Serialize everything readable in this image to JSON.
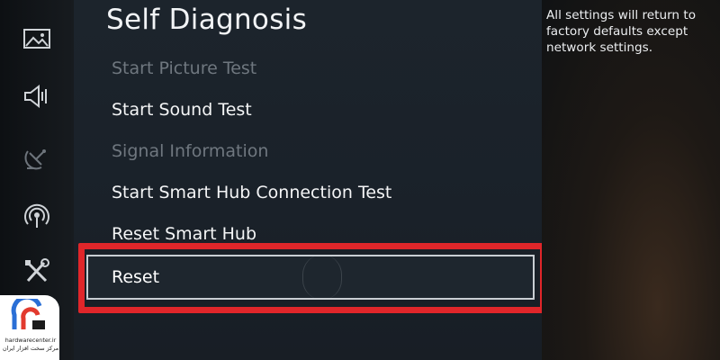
{
  "title": "Self Diagnosis",
  "menu": {
    "items": [
      {
        "label": "Start Picture Test",
        "state": "disabled"
      },
      {
        "label": "Start Sound Test",
        "state": "enabled"
      },
      {
        "label": "Signal Information",
        "state": "disabled"
      },
      {
        "label": "Start Smart Hub Connection Test",
        "state": "enabled"
      },
      {
        "label": "Reset Smart Hub",
        "state": "enabled"
      },
      {
        "label": "Reset",
        "state": "focused"
      }
    ]
  },
  "info": {
    "text": "All settings will return to factory defaults except network settings."
  },
  "sidebar": {
    "icons": [
      "picture-icon",
      "sound-icon",
      "broadcast-icon",
      "network-icon",
      "support-icon"
    ]
  },
  "highlight_color": "#e0262a",
  "watermark": {
    "site": "hardwarecenter.ir",
    "tagline": "مرکز سخت افزار ایران"
  }
}
